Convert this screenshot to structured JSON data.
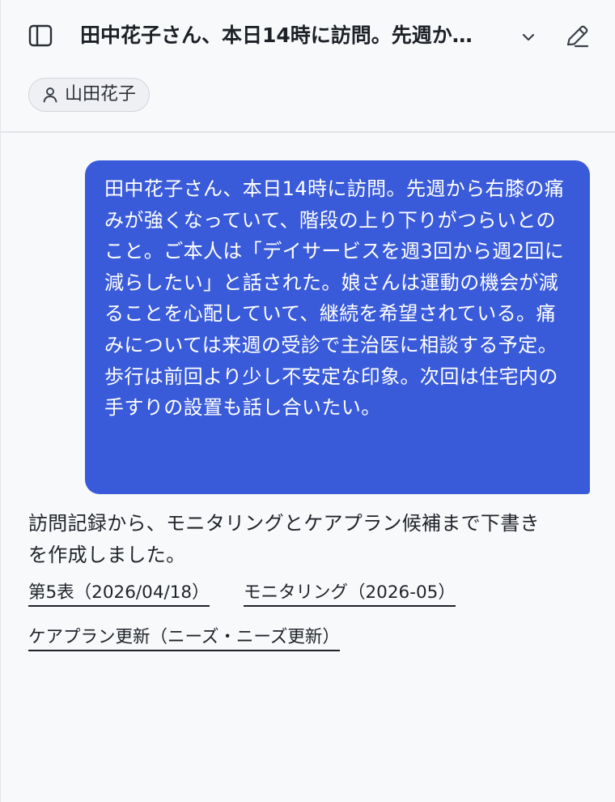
{
  "header": {
    "title": "田中花子さん、本日14時に訪問。先週か…",
    "user_chip_label": "山田花子"
  },
  "icons": {
    "sidebar_toggle": "sidebar-panel-icon",
    "title_dropdown": "chevron-down-icon",
    "edit": "pencil-icon",
    "user": "person-icon"
  },
  "message": {
    "user_text": "田中花子さん、本日14時に訪問。先週から右膝の痛みが強くなっていて、階段の上り下りがつらいとのこと。ご本人は「デイサービスを週3回から週2回に減らしたい」と話された。娘さんは運動の機会が減ることを心配していて、継続を希望されている。痛みについては来週の受診で主治医に相談する予定。歩行は前回より少し不安定な印象。次回は住宅内の手すりの設置も話し合いたい。"
  },
  "response": {
    "text": "訪問記録から、モニタリングとケアプラン候補まで下書きを作成しました。",
    "links": [
      "第5表（2026/04/18）",
      "モニタリング（2026-05）",
      "ケアプラン更新（ニーズ・ニーズ更新）"
    ]
  },
  "colors": {
    "accent": "#3a5bd9",
    "background": "#f8f9fb",
    "text": "#1f2328"
  }
}
